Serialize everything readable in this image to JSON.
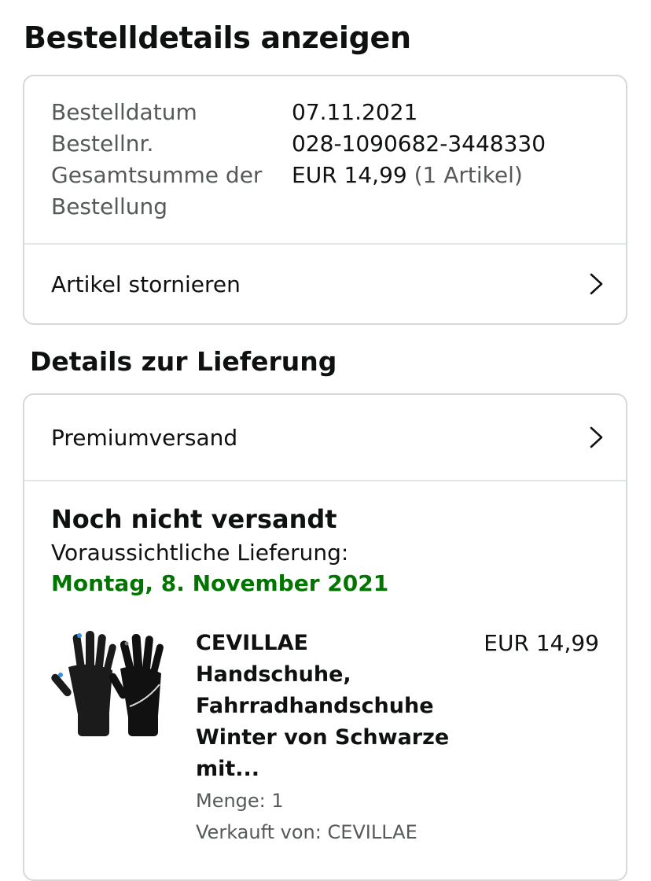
{
  "page": {
    "title": "Bestelldetails anzeigen"
  },
  "order": {
    "date_label": "Bestelldatum",
    "date_value": "07.11.2021",
    "number_label": "Bestellnr.",
    "number_value": "028-1090682-3448330",
    "total_label_line1": "Gesamtsumme der",
    "total_label_line2": "Bestellung",
    "total_value": "EUR 14,99",
    "total_count": "(1 Artikel)",
    "cancel_label": "Artikel stornieren"
  },
  "delivery": {
    "section_title": "Details zur Lieferung",
    "shipping_method": "Premiumversand",
    "status": "Noch nicht versandt",
    "eta_label": "Voraussichtliche Lieferung:",
    "eta_date": "Montag, 8. November 2021",
    "item": {
      "title_lines": [
        "CEVILLAE Handschuhe,",
        "Fahrradhandschuhe",
        "Winter von Schwarze",
        "mit..."
      ],
      "price": "EUR 14,99",
      "quantity": "Menge: 1",
      "seller": "Verkauft von: CEVILLAE"
    }
  },
  "icons": {
    "chevron": "chevron-right-icon",
    "product_image": "black-gloves-image"
  },
  "colors": {
    "delivery_date": "#007600",
    "border": "#d5d9d9",
    "muted_text": "#565959"
  }
}
